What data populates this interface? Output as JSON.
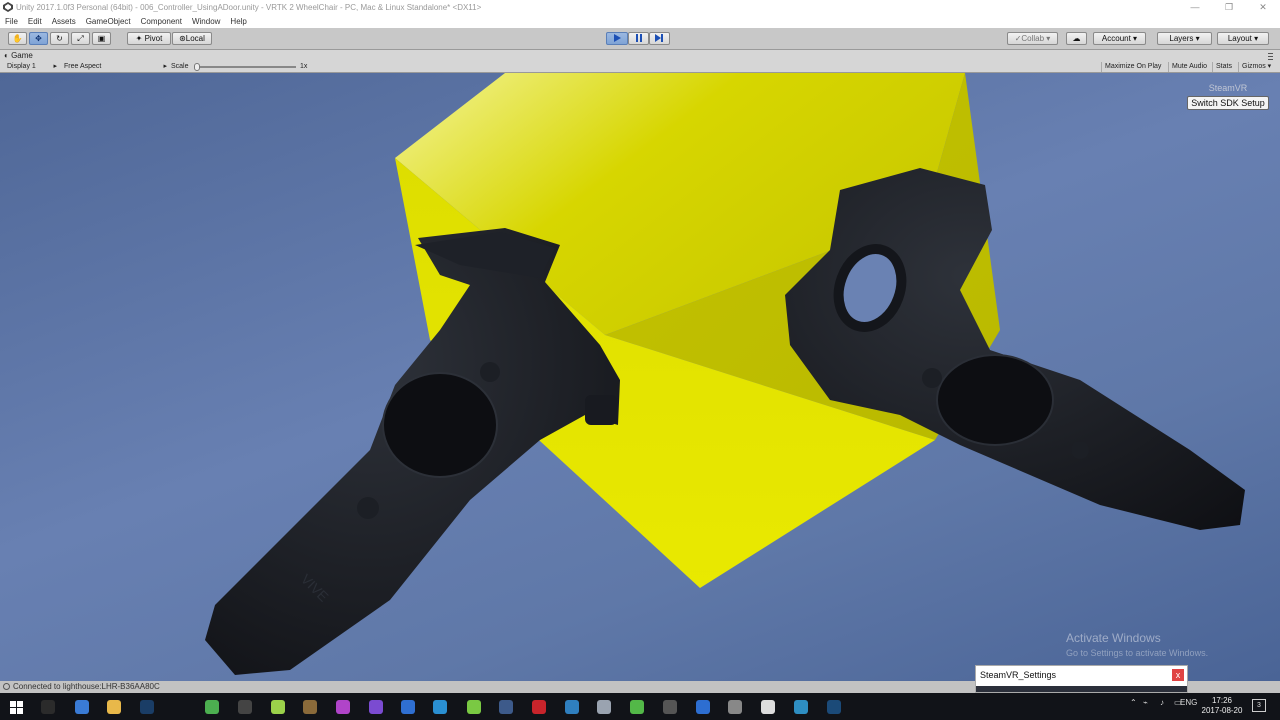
{
  "window": {
    "title": "Unity 2017.1.0f3 Personal (64bit) - 006_Controller_UsingADoor.unity - VRTK 2 WheelChair - PC, Mac & Linux Standalone* <DX11>",
    "controls": [
      "—",
      "❐",
      "✕"
    ]
  },
  "menu": [
    "File",
    "Edit",
    "Assets",
    "GameObject",
    "Component",
    "Window",
    "Help"
  ],
  "toolbar": {
    "pivot_label": "Pivot",
    "local_label": "Local",
    "collab_label": "Collab ▾",
    "account_label": "Account ▾",
    "layers_label": "Layers ▾",
    "layout_label": "Layout ▾",
    "transform_tools": [
      "hand-tool-icon",
      "move-tool-icon",
      "rotate-tool-icon",
      "scale-tool-icon",
      "rect-tool-icon"
    ],
    "play_state": "playing"
  },
  "game_view": {
    "tab_label": "Game",
    "display": "Display 1",
    "aspect": "Free Aspect",
    "scale_label": "Scale",
    "scale_value": "1x",
    "maximize_label": "Maximize On Play",
    "mute_label": "Mute Audio",
    "stats_label": "Stats",
    "gizmos_label": "Gizmos ▾",
    "steamvr_label": "SteamVR",
    "sdk_button": "Switch SDK Setup",
    "controller_brand": "VIVE"
  },
  "watermark": {
    "line1": "Activate Windows",
    "line2": "Go to Settings to activate Windows."
  },
  "status": {
    "text": "Connected to lighthouse:LHR-B36AA80C"
  },
  "steamvr_settings": {
    "title": "SteamVR_Settings",
    "close": "x"
  },
  "taskbar": {
    "language": "ENG",
    "time": "17:26",
    "date": "2017-08-20",
    "notifications": "3",
    "apps": [
      {
        "name": "task-view-icon",
        "color": "#2b2b2b"
      },
      {
        "name": "edge-like-icon",
        "color": "#3a7bd5"
      },
      {
        "name": "file-explorer-icon",
        "color": "#e8b84a"
      },
      {
        "name": "photoshop-icon",
        "color": "#1a3d66"
      },
      {
        "name": "chrome-icon",
        "color": "#4caf50"
      },
      {
        "name": "terminal-icon",
        "color": "#444"
      },
      {
        "name": "git-icon",
        "color": "#9bd14a"
      },
      {
        "name": "storage-icon",
        "color": "#8a6a3a"
      },
      {
        "name": "phpstorm-icon",
        "color": "#b044c9"
      },
      {
        "name": "visual-studio-icon",
        "color": "#7b4bd1"
      },
      {
        "name": "app-blue-icon",
        "color": "#2f6fd1"
      },
      {
        "name": "app-cyan-icon",
        "color": "#2a8fd1"
      },
      {
        "name": "sourcetree-icon",
        "color": "#7ac943"
      },
      {
        "name": "settings-gear-icon",
        "color": "#3d5a8a"
      },
      {
        "name": "filezilla-icon",
        "color": "#c8242b"
      },
      {
        "name": "blender-like-icon",
        "color": "#2f7fbf"
      },
      {
        "name": "sd-card-icon",
        "color": "#9aa3b0"
      },
      {
        "name": "utorrent-icon",
        "color": "#53b848"
      },
      {
        "name": "fb-icon",
        "color": "#555"
      },
      {
        "name": "clock-app-icon",
        "color": "#2d6ed1"
      },
      {
        "name": "unity-hub-icon",
        "color": "#888"
      },
      {
        "name": "unity-icon",
        "color": "#ddd"
      },
      {
        "name": "circle-app-icon",
        "color": "#2e8ec2"
      },
      {
        "name": "steam-icon",
        "color": "#1b4a78"
      }
    ]
  },
  "colors": {
    "sky": "#5f78a8",
    "cube_yellow": "#d2d200",
    "controller": "#16181d"
  }
}
